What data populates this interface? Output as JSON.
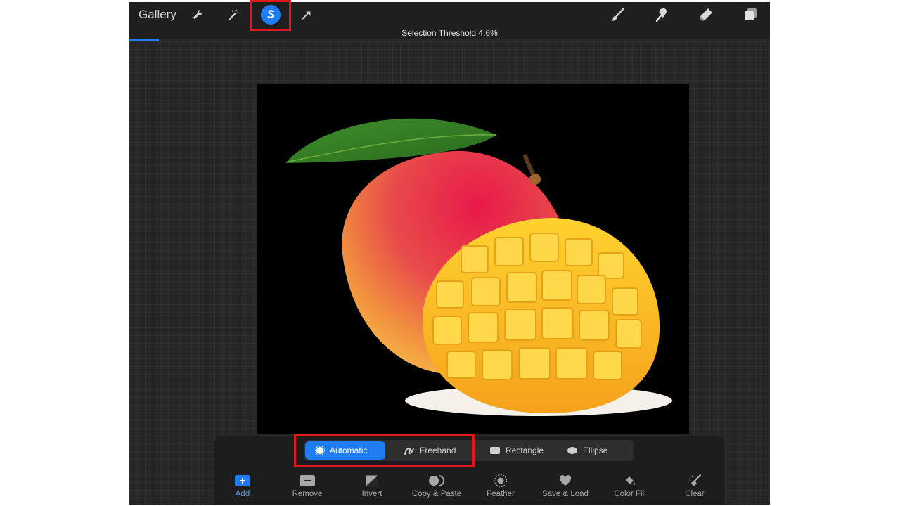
{
  "header": {
    "gallery_label": "Gallery",
    "status": "Selection Threshold 4.6%",
    "threshold_percent": 4.6,
    "left_tools": [
      "wrench-icon",
      "magic-wand-icon",
      "selection-icon",
      "transform-arrow-icon"
    ],
    "right_tools": [
      "brush-icon",
      "smudge-icon",
      "eraser-icon",
      "layers-icon"
    ],
    "active_tool": "selection-icon"
  },
  "selection_modes": [
    {
      "label": "Automatic",
      "icon": "automatic-icon",
      "active": true
    },
    {
      "label": "Freehand",
      "icon": "freehand-icon",
      "active": false
    },
    {
      "label": "Rectangle",
      "icon": "rectangle-icon",
      "active": false
    },
    {
      "label": "Ellipse",
      "icon": "ellipse-icon",
      "active": false
    }
  ],
  "actions": [
    {
      "label": "Add",
      "icon": "add-icon",
      "active": true
    },
    {
      "label": "Remove",
      "icon": "remove-icon",
      "active": false
    },
    {
      "label": "Invert",
      "icon": "invert-icon",
      "active": false
    },
    {
      "label": "Copy & Paste",
      "icon": "copy-paste-icon",
      "active": false
    },
    {
      "label": "Feather",
      "icon": "feather-icon",
      "active": false
    },
    {
      "label": "Save & Load",
      "icon": "heart-icon",
      "active": false
    },
    {
      "label": "Color Fill",
      "icon": "color-fill-icon",
      "active": false
    },
    {
      "label": "Clear",
      "icon": "clear-brush-icon",
      "active": false
    }
  ],
  "colors": {
    "accent": "#1f7cf2",
    "highlight": "#e3161c",
    "canvas": "#000000"
  }
}
